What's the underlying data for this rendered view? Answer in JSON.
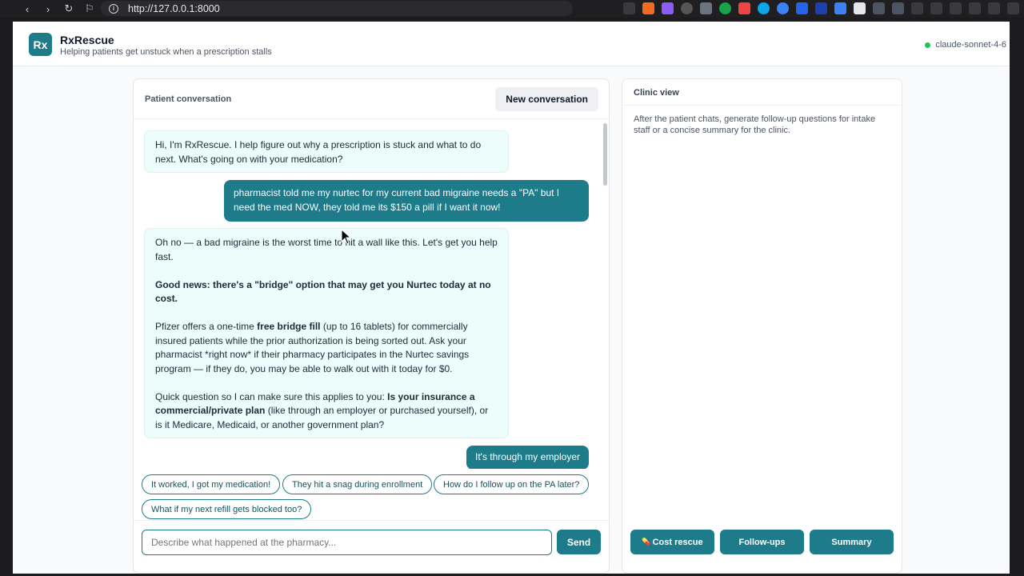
{
  "browser": {
    "url": "http://127.0.0.1:8000",
    "nav": {
      "back": "‹",
      "forward": "›",
      "reload": "↻",
      "bookmark": "⚐"
    }
  },
  "app": {
    "logo_text": "Rx",
    "title": "RxRescue",
    "subtitle": "Helping patients get unstuck when a prescription stalls",
    "model": "claude-sonnet-4-6"
  },
  "chat": {
    "header": "Patient conversation",
    "new_conversation": "New conversation",
    "messages": [
      {
        "role": "assistant",
        "text": "Hi, I'm RxRescue. I help figure out why a prescription is stuck and what to do next. What's going on with your medication?"
      },
      {
        "role": "user",
        "text": "pharmacist told me my nurtec for my current bad migraine needs a \"PA\" but I need the med NOW, they told me its $150 a pill if I want it now!"
      },
      {
        "role": "assistant",
        "p1": "Oh no — a bad migraine is the worst time to hit a wall like this. Let's get you help fast.",
        "p2_bold": "Good news: there's a \"bridge\" option that may get you Nurtec today at no cost.",
        "p3_a": "Pfizer offers a one-time ",
        "p3_b": "free bridge fill",
        "p3_c": " (up to 16 tablets) for commercially insured patients while the prior authorization is being sorted out. Ask your pharmacist *right now* if their pharmacy participates in the Nurtec savings program — if they do, you may be able to walk out with it today for $0.",
        "p4_a": "Quick question so I can make sure this applies to you: ",
        "p4_b": "Is your insurance a commercial/private plan",
        "p4_c": " (like through an employer or purchased yourself), or is it Medicare, Medicaid, or another government plan?"
      },
      {
        "role": "user",
        "text": "It's through my employer"
      }
    ],
    "quick_replies": [
      "It worked, I got my medication!",
      "They hit a snag during enrollment",
      "How do I follow up on the PA later?",
      "What if my next refill gets blocked too?"
    ],
    "input_placeholder": "Describe what happened at the pharmacy...",
    "send": "Send"
  },
  "clinic": {
    "header": "Clinic view",
    "description": "After the patient chats, generate follow-up questions for intake staff or a concise summary for the clinic.",
    "actions": {
      "cost_rescue_icon": "💊",
      "cost_rescue": "Cost rescue",
      "followups": "Follow-ups",
      "summary": "Summary"
    }
  },
  "colors": {
    "accent": "#1e7b8a",
    "bot_bubble": "#ecfdfb",
    "status_online": "#22c55e"
  }
}
